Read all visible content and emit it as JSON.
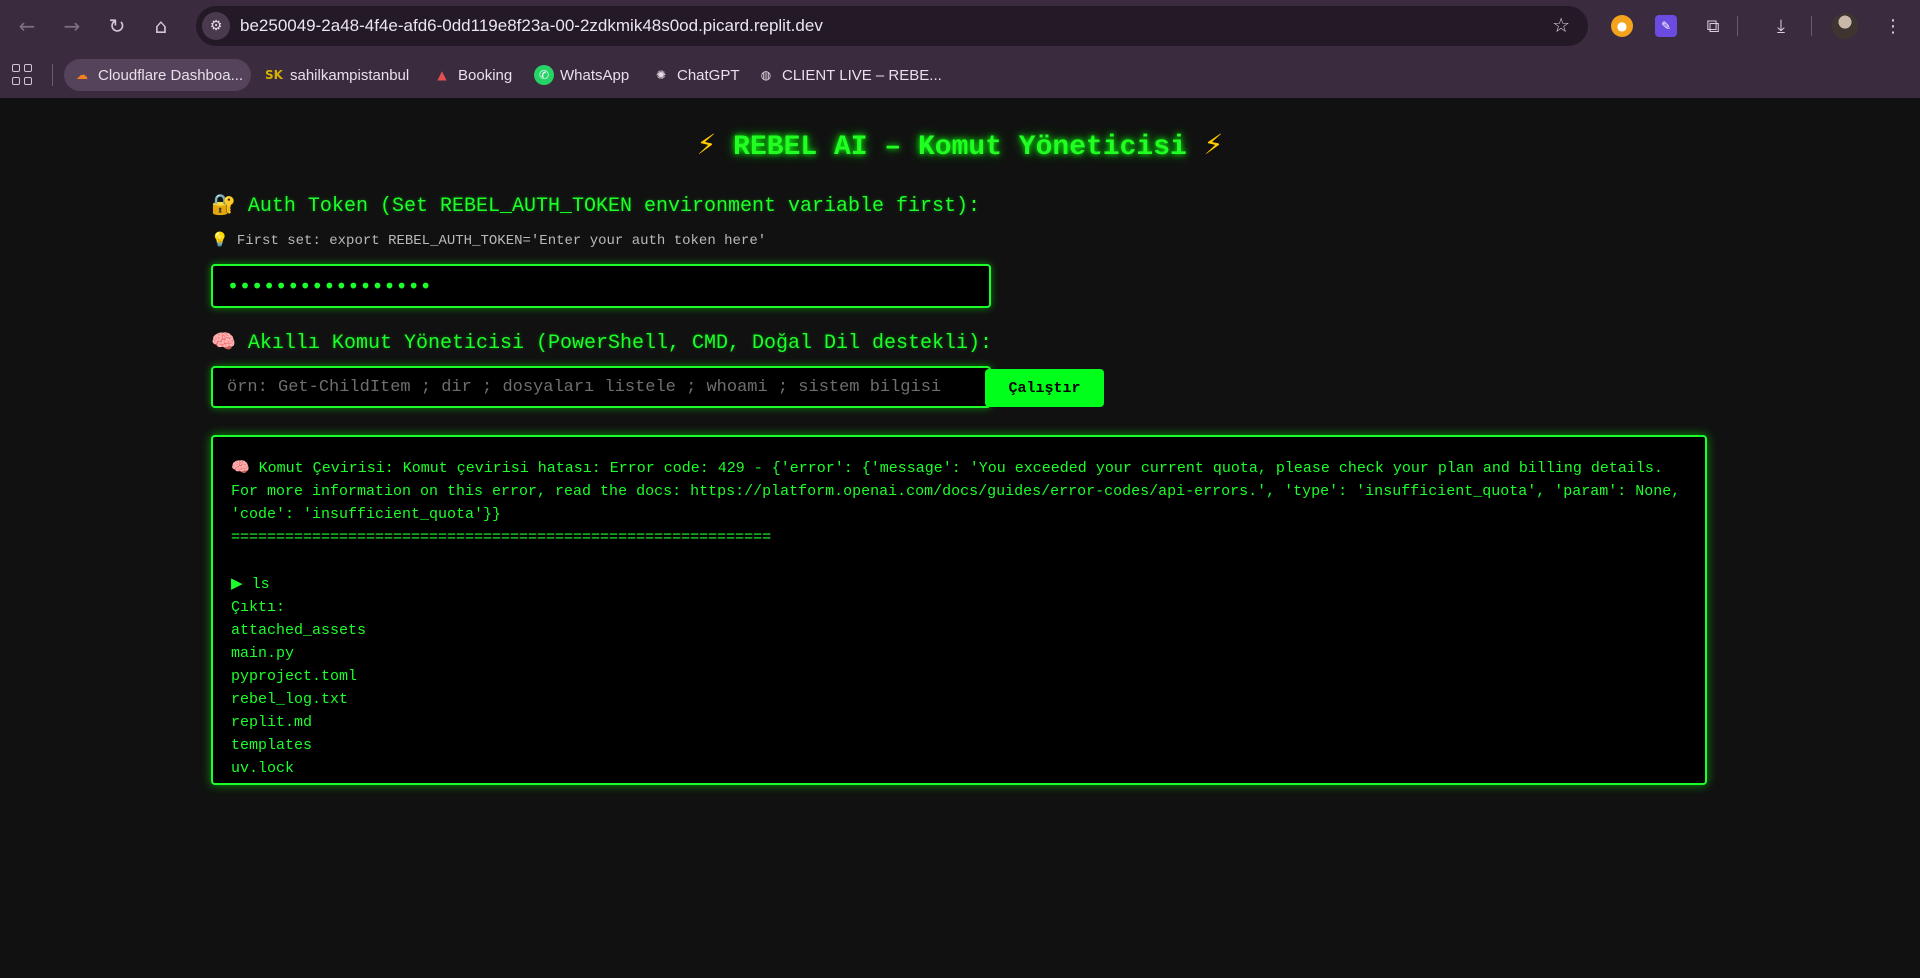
{
  "browser": {
    "url": "be250049-2a48-4f4e-afd6-0dd119e8f23a-00-2zdkmik48s0od.picard.replit.dev",
    "bookmarks": [
      {
        "label": "Cloudflare Dashboa...",
        "icon": "cloudflare-icon"
      },
      {
        "label": "sahilkampistanbul",
        "icon": "sk-icon"
      },
      {
        "label": "Booking",
        "icon": "booking-icon"
      },
      {
        "label": "WhatsApp",
        "icon": "whatsapp-icon"
      },
      {
        "label": "ChatGPT",
        "icon": "chatgpt-icon"
      },
      {
        "label": "CLIENT LIVE – REBE...",
        "icon": "globe-icon"
      }
    ]
  },
  "app": {
    "title": "REBEL AI – Komut Yöneticisi",
    "auth": {
      "label": "Auth Token (Set REBEL_AUTH_TOKEN environment variable first):",
      "hint": "First set: export REBEL_AUTH_TOKEN='Enter your auth token here'",
      "value": "ABCDEFGHIJKLMNOPQ"
    },
    "command": {
      "label": "Akıllı Komut Yöneticisi (PowerShell, CMD, Doğal Dil destekli):",
      "placeholder": "örn: Get-ChildItem ; dir ; dosyaları listele ; whoami ; sistem bilgisi",
      "value": "",
      "run_label": "Çalıştır"
    },
    "output": {
      "error_text": "🧠 Komut Çevirisi: Komut çevirisi hatası: Error code: 429 - {'error': {'message': 'You exceeded your current quota, please check your plan and billing details. For more information on this error, read the docs: https://platform.openai.com/docs/guides/error-codes/api-errors.', 'type': 'insufficient_quota', 'param': None, 'code': 'insufficient_quota'}}",
      "separator": "============================================================",
      "command": "ls",
      "output_label": "Çıktı:",
      "files": [
        "attached_assets",
        "main.py",
        "pyproject.toml",
        "rebel_log.txt",
        "replit.md",
        "templates",
        "uv.lock"
      ]
    },
    "colors": {
      "accent": "#1dff2b",
      "background": "#111111",
      "button": "#00ff1a"
    }
  }
}
